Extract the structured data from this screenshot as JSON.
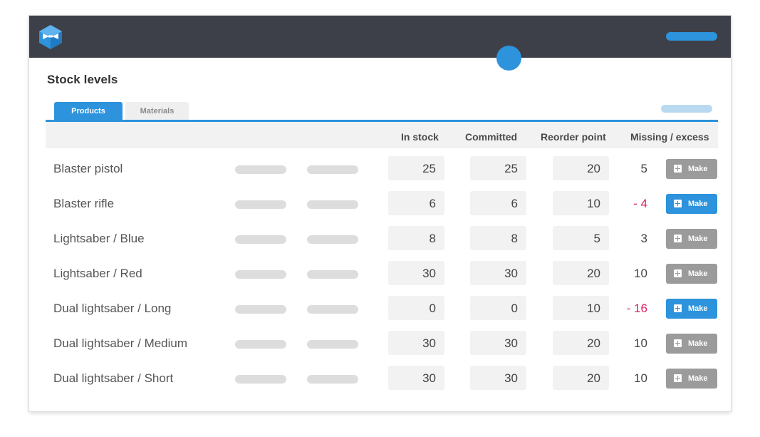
{
  "app": {
    "logo_icon": "bowtie-cube-logo-icon",
    "accent_color": "#2d93dc",
    "topbar_color": "#3e4049"
  },
  "page": {
    "title": "Stock levels"
  },
  "tabs": [
    {
      "label": "Products",
      "active": true
    },
    {
      "label": "Materials",
      "active": false
    }
  ],
  "table": {
    "columns": {
      "in_stock": "In stock",
      "committed": "Committed",
      "reorder_point": "Reorder point",
      "missing_excess": "Missing / excess"
    },
    "make_label": "Make",
    "rows": [
      {
        "name": "Blaster pistol",
        "in_stock": "25",
        "committed": "25",
        "reorder_point": "20",
        "missing": "5",
        "negative": false
      },
      {
        "name": "Blaster rifle",
        "in_stock": "6",
        "committed": "6",
        "reorder_point": "10",
        "missing": "- 4",
        "negative": true
      },
      {
        "name": "Lightsaber / Blue",
        "in_stock": "8",
        "committed": "8",
        "reorder_point": "5",
        "missing": "3",
        "negative": false
      },
      {
        "name": "Lightsaber / Red",
        "in_stock": "30",
        "committed": "30",
        "reorder_point": "20",
        "missing": "10",
        "negative": false
      },
      {
        "name": "Dual lightsaber / Long",
        "in_stock": "0",
        "committed": "0",
        "reorder_point": "10",
        "missing": "- 16",
        "negative": true
      },
      {
        "name": "Dual lightsaber / Medium",
        "in_stock": "30",
        "committed": "30",
        "reorder_point": "20",
        "missing": "10",
        "negative": false
      },
      {
        "name": "Dual lightsaber / Short",
        "in_stock": "30",
        "committed": "30",
        "reorder_point": "20",
        "missing": "10",
        "negative": false
      }
    ]
  }
}
